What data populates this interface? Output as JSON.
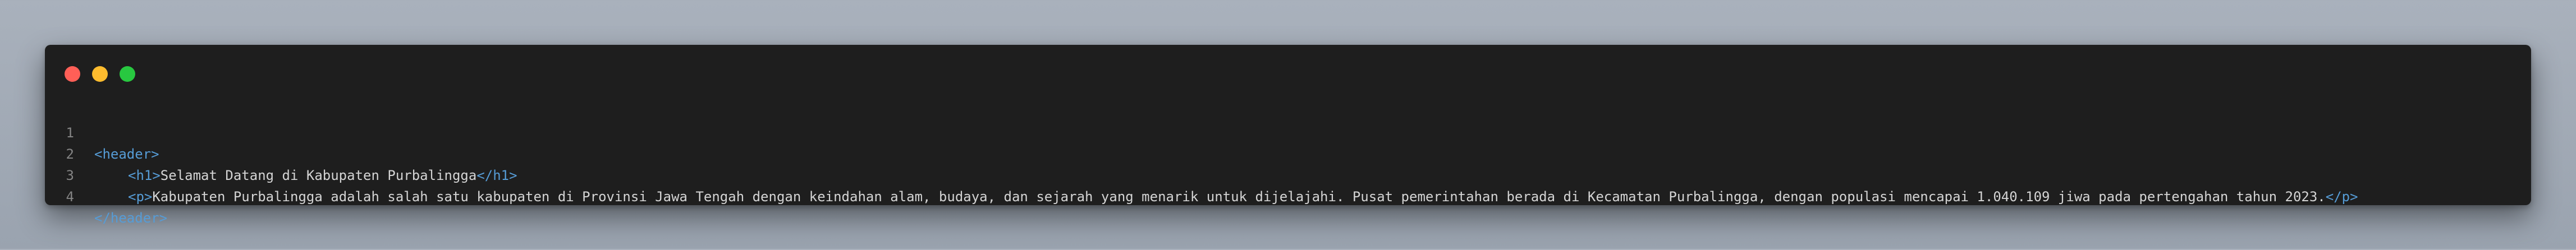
{
  "window": {
    "controls": [
      {
        "name": "close",
        "color": "#ff5f57"
      },
      {
        "name": "minimize",
        "color": "#febc2e"
      },
      {
        "name": "maximize",
        "color": "#28c840"
      }
    ]
  },
  "code": {
    "lines": [
      {
        "number": "1",
        "open": "<header>",
        "text": "",
        "close": ""
      },
      {
        "number": "2",
        "open": "<h1>",
        "text": "Selamat Datang di Kabupaten Purbalingga",
        "close": "</h1>"
      },
      {
        "number": "3",
        "open": "<p>",
        "text": "Kabupaten Purbalingga adalah salah satu kabupaten di Provinsi Jawa Tengah dengan keindahan alam, budaya, dan sejarah yang menarik untuk dijelajahi. Pusat pemerintahan berada di Kecamatan Purbalingga, dengan populasi mencapai 1.040.109 jiwa pada pertengahan tahun 2023.",
        "close": "</p>"
      },
      {
        "number": "4",
        "open": "</header>",
        "text": "",
        "close": ""
      }
    ]
  },
  "colors": {
    "tag": "#569cd6",
    "text": "#d4d4d4",
    "line_number": "#858585",
    "background": "#1e1e1e"
  }
}
